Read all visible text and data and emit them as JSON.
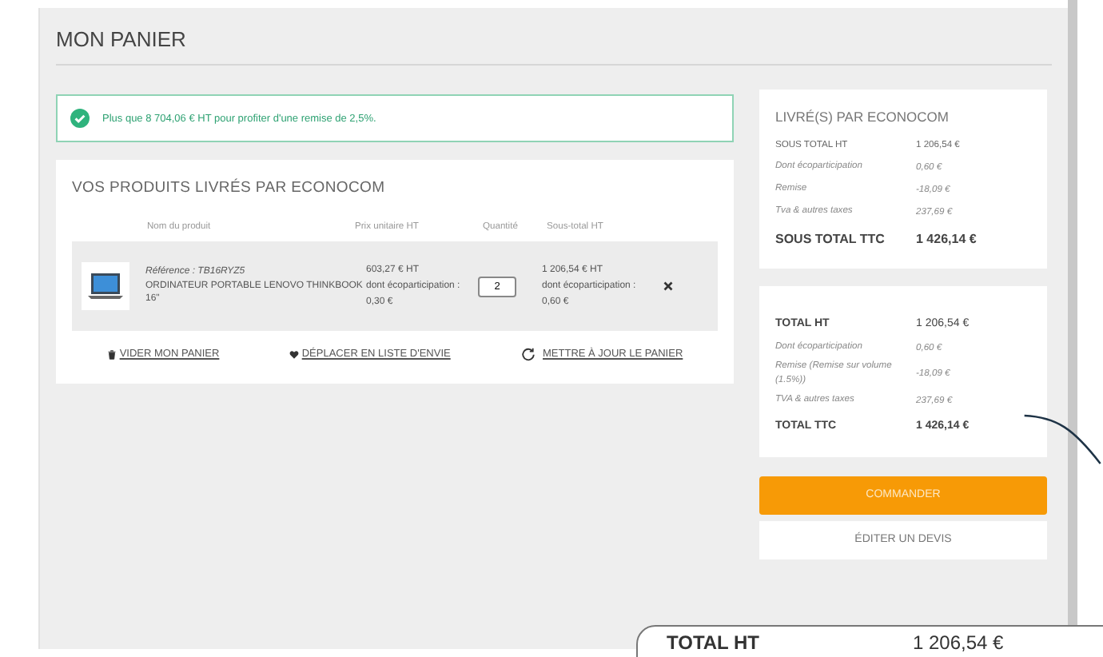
{
  "page_title": "MON PANIER",
  "notice": {
    "text": "Plus que 8 704,06 € HT pour profiter d'une remise de 2,5%."
  },
  "products": {
    "title": "VOS PRODUITS LIVRÉS PAR ECONOCOM",
    "columns": [
      "Nom du produit",
      "Prix unitaire HT",
      "Quantité",
      "Sous-total HT"
    ],
    "items": [
      {
        "reference": "Référence : TB16RYZ5",
        "name": "ORDINATEUR PORTABLE LENOVO THINKBOOK 16\"",
        "unit_price": "603,27 € HT",
        "unit_eco": "dont écoparticipation : 0,30 €",
        "quantity": "2",
        "subtotal": "1 206,54 € HT",
        "subtotal_eco": "dont écoparticipation : 0,60 €"
      }
    ],
    "actions": [
      {
        "kind": "trash",
        "label": "VIDER MON PANIER"
      },
      {
        "kind": "heart",
        "label": "DÉPLACER EN LISTE D'ENVIE"
      },
      {
        "kind": "refresh",
        "label": "METTRE À JOUR LE PANIER"
      }
    ]
  },
  "delivered_summary": {
    "title": "LIVRÉ(S) PAR ECONOCOM",
    "rows": [
      {
        "kind": "main",
        "label": "SOUS TOTAL HT",
        "value": "1 206,54 €"
      },
      {
        "kind": "sub",
        "label": "Dont écoparticipation",
        "value": "0,60 €"
      },
      {
        "kind": "sub",
        "label": "Remise",
        "value": "-18,09 €"
      },
      {
        "kind": "sub",
        "label": "Tva & autres taxes",
        "value": "237,69 €"
      },
      {
        "kind": "total",
        "label": "SOUS TOTAL TTC",
        "value": "1 426,14 €"
      }
    ]
  },
  "totals": {
    "rows": [
      {
        "kind": "total",
        "label": "TOTAL HT",
        "value": "1 206,54 €"
      },
      {
        "kind": "sub",
        "label": "Dont écoparticipation",
        "value": "0,60 €"
      },
      {
        "kind": "sub",
        "label": "Remise (Remise sur volume (1.5%))",
        "value": "-18,09 €"
      },
      {
        "kind": "sub",
        "label": "TVA & autres taxes",
        "value": "237,69 €"
      },
      {
        "kind": "total",
        "label": "TOTAL TTC",
        "value": "1 426,14 €"
      }
    ]
  },
  "buttons": [
    {
      "kind": "primary",
      "label": "COMMANDER"
    },
    {
      "kind": "secondary",
      "label": "ÉDITER UN DEVIS"
    }
  ],
  "callout": {
    "label": "TOTAL HT",
    "value": "1 206,54 €"
  }
}
